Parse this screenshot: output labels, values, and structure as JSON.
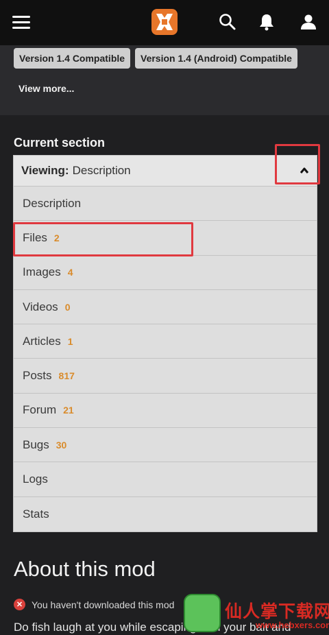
{
  "header": {
    "menu_icon": "hamburger-icon",
    "logo": "nexus-logo",
    "search_icon": "search-icon",
    "notifications_icon": "bell-icon",
    "account_icon": "user-icon"
  },
  "tags": [
    "Version 1.4 Compatible",
    "Version 1.4 (Android) Compatible"
  ],
  "view_more": "View more...",
  "current_section": {
    "title": "Current section",
    "viewing_label": "Viewing:",
    "viewing_value": "Description",
    "items": [
      {
        "label": "Description",
        "count": ""
      },
      {
        "label": "Files",
        "count": "2"
      },
      {
        "label": "Images",
        "count": "4"
      },
      {
        "label": "Videos",
        "count": "0"
      },
      {
        "label": "Articles",
        "count": "1"
      },
      {
        "label": "Posts",
        "count": "817"
      },
      {
        "label": "Forum",
        "count": "21"
      },
      {
        "label": "Bugs",
        "count": "30"
      },
      {
        "label": "Logs",
        "count": ""
      },
      {
        "label": "Stats",
        "count": ""
      }
    ]
  },
  "about": {
    "title": "About this mod",
    "notice": "You haven't downloaded this mod",
    "description_start": "Do fish laugh at you while escaping with your bait and"
  },
  "watermark": {
    "text": "仙人掌下载网",
    "url": "www.hebxers.com"
  },
  "colors": {
    "accent_orange": "#d98b2b",
    "highlight_red": "#e0393f",
    "background": "#1f1f21"
  }
}
